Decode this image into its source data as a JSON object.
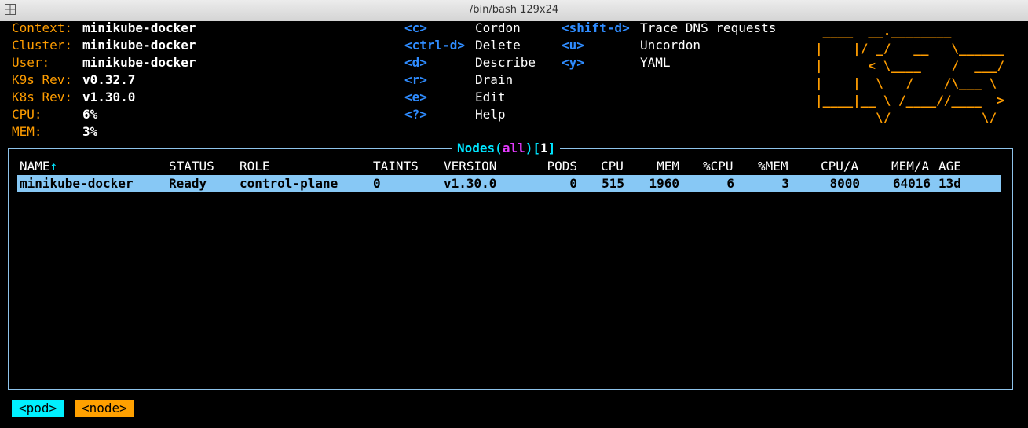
{
  "window": {
    "title": "/bin/bash 129x24"
  },
  "info": [
    {
      "label": "Context:",
      "value": "minikube-docker"
    },
    {
      "label": "Cluster:",
      "value": "minikube-docker"
    },
    {
      "label": "User:",
      "value": "minikube-docker"
    },
    {
      "label": "K9s Rev:",
      "value": "v0.32.7"
    },
    {
      "label": "K8s Rev:",
      "value": "v1.30.0"
    },
    {
      "label": "CPU:",
      "value": "6%"
    },
    {
      "label": "MEM:",
      "value": "3%"
    }
  ],
  "shortcuts_left": [
    {
      "key": "<c>",
      "action": "Cordon"
    },
    {
      "key": "<ctrl-d>",
      "action": "Delete"
    },
    {
      "key": "<d>",
      "action": "Describe"
    },
    {
      "key": "<r>",
      "action": "Drain"
    },
    {
      "key": "<e>",
      "action": "Edit"
    },
    {
      "key": "<?>",
      "action": "Help"
    }
  ],
  "shortcuts_right": [
    {
      "key": "<shift-d>",
      "action": "Trace DNS requests"
    },
    {
      "key": "<u>",
      "action": "Uncordon"
    },
    {
      "key": "<y>",
      "action": "YAML"
    }
  ],
  "logo": " ____  __.________\n|    |/ _/   __   \\______\n|      < \\____    /  ___/\n|    |  \\   /    /\\___ \\\n|____|__ \\ /____//____  >\n        \\/            \\/",
  "table": {
    "title": "Nodes",
    "filter": "all",
    "count": "1",
    "sort_arrow": "↑",
    "columns": [
      "NAME",
      "STATUS",
      "ROLE",
      "TAINTS",
      "VERSION",
      "PODS",
      "CPU",
      "MEM",
      "%CPU",
      "%MEM",
      "CPU/A",
      "MEM/A",
      "AGE"
    ],
    "rows": [
      [
        "minikube-docker",
        "Ready",
        "control-plane",
        "0",
        "v1.30.0",
        "0",
        "515",
        "1960",
        "6",
        "3",
        "8000",
        "64016",
        "13d"
      ]
    ]
  },
  "crumbs": [
    "<pod>",
    "<node>"
  ],
  "colors": {
    "label": "#ff9d00",
    "key": "#2f8cff",
    "frame": "#8ec3ea",
    "title": "#00e5ff",
    "filter": "#e53bff",
    "selection": "#87c8f5",
    "crumb_pod": "#00f0ff",
    "crumb_node": "#ffa000"
  }
}
